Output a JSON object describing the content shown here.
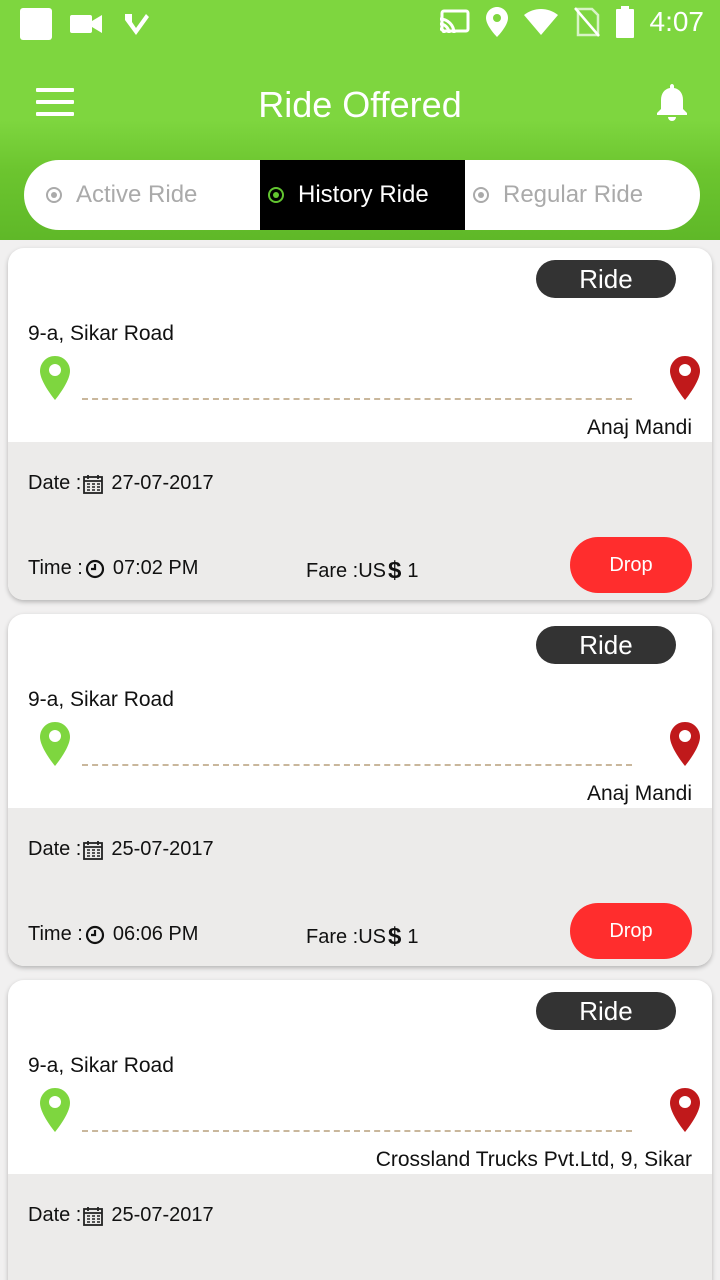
{
  "status_bar": {
    "time": "4:07",
    "icons": [
      "app-square-icon",
      "video-camera-icon",
      "checkmark-app-icon",
      "cast-icon",
      "location-icon",
      "wifi-icon",
      "no-sim-icon",
      "battery-icon"
    ]
  },
  "app_bar": {
    "title": "Ride Offered",
    "menu_icon": "hamburger-menu-icon",
    "notification_icon": "bell-icon"
  },
  "tabs": [
    {
      "label": "Active Ride",
      "selected": false
    },
    {
      "label": "History Ride",
      "selected": true
    },
    {
      "label": "Regular Ride",
      "selected": false
    }
  ],
  "colors": {
    "header_green": "#7ed63f",
    "selected_tab_bg": "#000000",
    "pin_green": "#7ed63f",
    "pin_red": "#c0191b",
    "drop_button": "#ff2d2d",
    "badge_bg": "#333333"
  },
  "rides": [
    {
      "badge": "Ride",
      "from": "9-a, Sikar Road",
      "to": "Anaj Mandi",
      "date_label": "Date :",
      "date": "27-07-2017",
      "time_label": "Time :",
      "time": "07:02 PM",
      "fare_label": "Fare :US",
      "fare_currency": "$",
      "fare_value": "1",
      "action": "Drop"
    },
    {
      "badge": "Ride",
      "from": "9-a, Sikar Road",
      "to": "Anaj Mandi",
      "date_label": "Date :",
      "date": "25-07-2017",
      "time_label": "Time :",
      "time": "06:06 PM",
      "fare_label": "Fare :US",
      "fare_currency": "$",
      "fare_value": "1",
      "action": "Drop"
    },
    {
      "badge": "Ride",
      "from": "9-a, Sikar Road",
      "to": "Crossland Trucks Pvt.Ltd, 9, Sikar",
      "date_label": "Date :",
      "date": "25-07-2017"
    }
  ]
}
